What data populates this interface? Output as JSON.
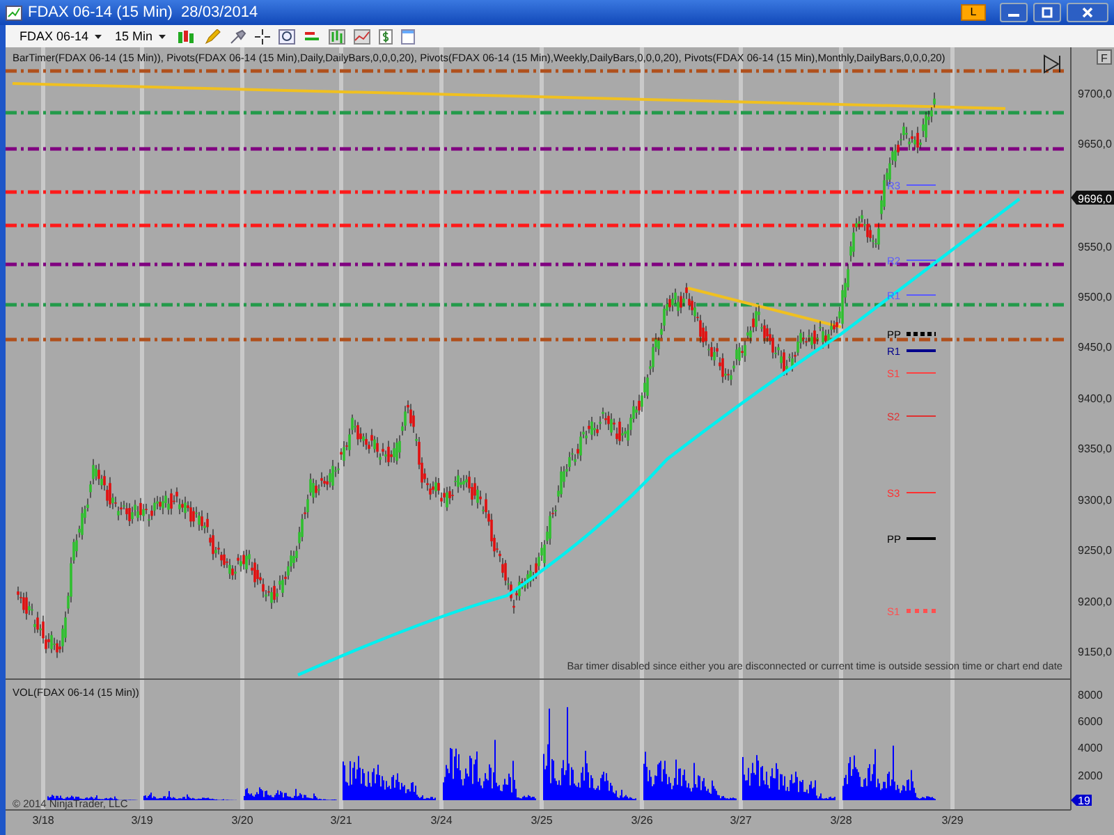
{
  "window": {
    "title": "FDAX 06-14 (15 Min)  28/03/2014",
    "link_badge": "L"
  },
  "toolbar": {
    "instrument": "FDAX 06-14",
    "interval": "15 Min"
  },
  "chart": {
    "indicator_header": "BarTimer(FDAX 06-14 (15 Min)), Pivots(FDAX 06-14 (15 Min),Daily,DailyBars,0,0,0,20), Pivots(FDAX 06-14 (15 Min),Weekly,DailyBars,0,0,0,20), Pivots(FDAX 06-14 (15 Min),Monthly,DailyBars,0,0,0,20)",
    "panel_button": "F",
    "price_ticks": [
      "9700,0",
      "9650,0",
      "9550,0",
      "9500,0",
      "9450,0",
      "9400,0",
      "9350,0",
      "9300,0",
      "9250,0",
      "9200,0",
      "9150,0"
    ],
    "last_price": "9696,0",
    "pivot_labels": [
      {
        "text": "R3",
        "color": "#5a5aff"
      },
      {
        "text": "R2",
        "color": "#5a5aff"
      },
      {
        "text": "R1",
        "color": "#5a5aff"
      },
      {
        "text": "PP",
        "color": "#000000"
      },
      {
        "text": "R1",
        "color": "#00008b"
      },
      {
        "text": "S1",
        "color": "#ff4040"
      },
      {
        "text": "S2",
        "color": "#e03030"
      },
      {
        "text": "S3",
        "color": "#ff3030"
      },
      {
        "text": "PP",
        "color": "#000000"
      },
      {
        "text": "S1",
        "color": "#ff5050"
      }
    ],
    "message": "Bar timer disabled since either you are disconnected or current time is outside session time or chart end date",
    "volume_title": "VOL(FDAX 06-14 (15 Min))",
    "volume_ticks": [
      "8000",
      "6000",
      "4000",
      "2000"
    ],
    "last_volume": "19",
    "copyright": "© 2014 NinjaTrader, LLC",
    "dates": [
      "3/18",
      "3/19",
      "3/20",
      "3/21",
      "3/24",
      "3/25",
      "3/26",
      "3/27",
      "3/28",
      "3/29"
    ]
  }
}
